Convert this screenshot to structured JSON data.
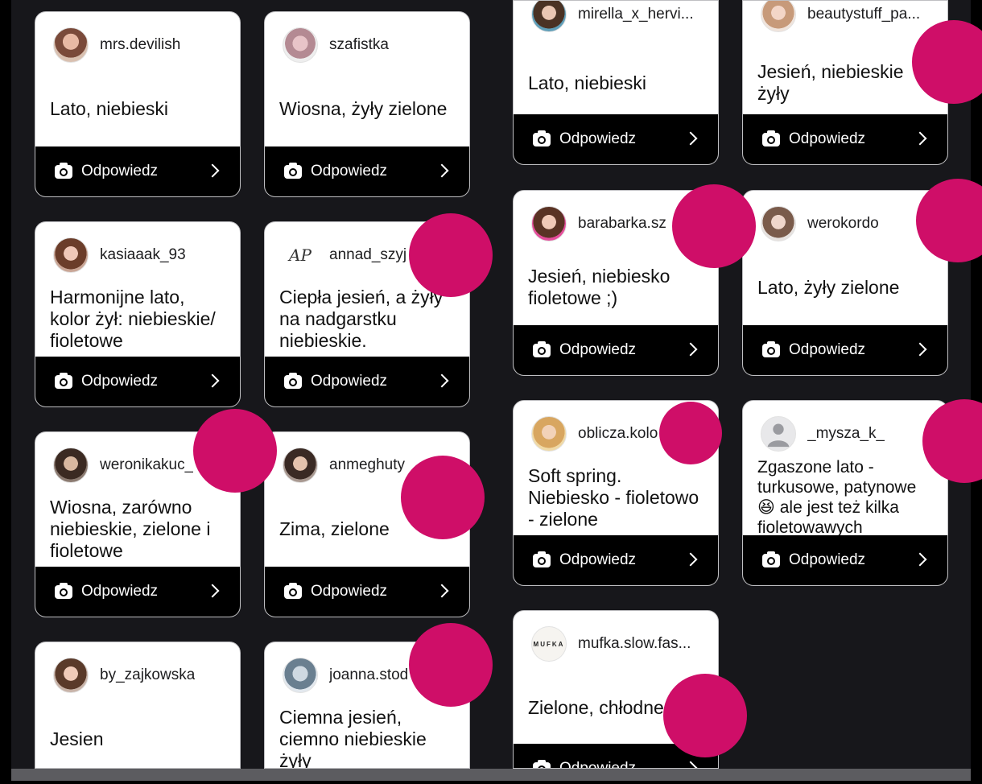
{
  "footer_label": "Odpowiedz",
  "accent_color": "#cf0e68",
  "cards_left": [
    {
      "username": "mrs.devilish",
      "answer": "Lato, niebieski"
    },
    {
      "username": "szafistka",
      "answer": "Wiosna, żyły zielone"
    },
    {
      "username": "kasiaaak_93",
      "answer": "Harmonijne lato, kolor żył: niebieskie/ fioletowe"
    },
    {
      "username": "annad_szyj",
      "answer": "Ciepła jesień, a żyły na nadgarstku niebieskie.",
      "avatar_text": "AP"
    },
    {
      "username": "weronikakuc_",
      "answer": "Wiosna, zarówno niebieskie, zielone i fioletowe"
    },
    {
      "username": "anmeghuty",
      "answer": "Zima, zielone"
    },
    {
      "username": "by_zajkowska",
      "answer": "Jesien"
    },
    {
      "username": "joanna.stod",
      "answer": "Ciemna jesień, ciemno niebieskie żyły"
    }
  ],
  "cards_right": [
    {
      "username": "mirella_x_hervi...",
      "answer": "Lato, niebieski"
    },
    {
      "username": "beautystuff_pa...",
      "answer": "Jesień, niebieskie żyły"
    },
    {
      "username": "barabarka.sz",
      "answer": "Jesień, niebiesko fioletowe ;)"
    },
    {
      "username": "werokordo",
      "answer": "Lato, żyły zielone"
    },
    {
      "username": "oblicza.kolo",
      "answer": "Soft spring. Niebiesko - fioletowo - zielone"
    },
    {
      "username": "_mysza_k_",
      "answer": "Zgaszone lato - turkusowe, patynowe 😆 ale jest też kilka fioletowawych"
    },
    {
      "username": "mufka.slow.fas...",
      "answer": "Zielone, chłodne lato",
      "avatar_text": "MUFKA"
    }
  ]
}
